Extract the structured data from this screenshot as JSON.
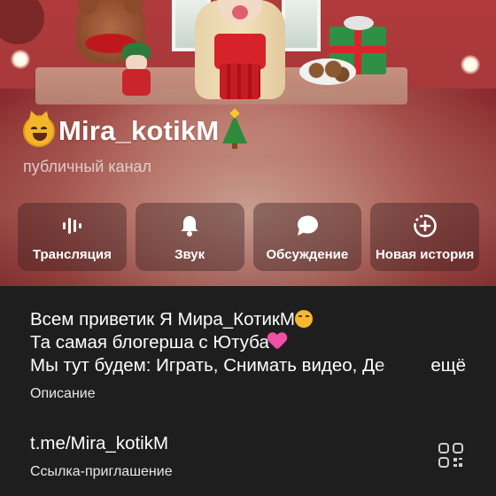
{
  "channel": {
    "name": "Mira_kotikM",
    "type_label": "публичный канал",
    "name_emoji_left": "cat-face-emoji",
    "name_emoji_right": "christmas-tree-emoji"
  },
  "actions": [
    {
      "label": "Трансляция",
      "icon": "broadcast-icon"
    },
    {
      "label": "Звук",
      "icon": "bell-icon"
    },
    {
      "label": "Обсуждение",
      "icon": "chat-bubble-icon"
    },
    {
      "label": "Новая история",
      "icon": "new-story-plus-icon"
    }
  ],
  "description": {
    "line1": "Всем приветик Я Мира_КотикМ",
    "line2": "Та самая блогерша с Ютуба",
    "line3": "Мы тут будем: Играть, Снимать видео, Де",
    "more": "ещё",
    "label": "Описание"
  },
  "invite": {
    "link": "t.me/Mira_kotikM",
    "label": "Ссылка-приглашение",
    "icon": "qr-code-icon"
  },
  "colors": {
    "background": "#1e1e1e",
    "hero_tint": "#a24a46",
    "text": "#ffffff"
  }
}
